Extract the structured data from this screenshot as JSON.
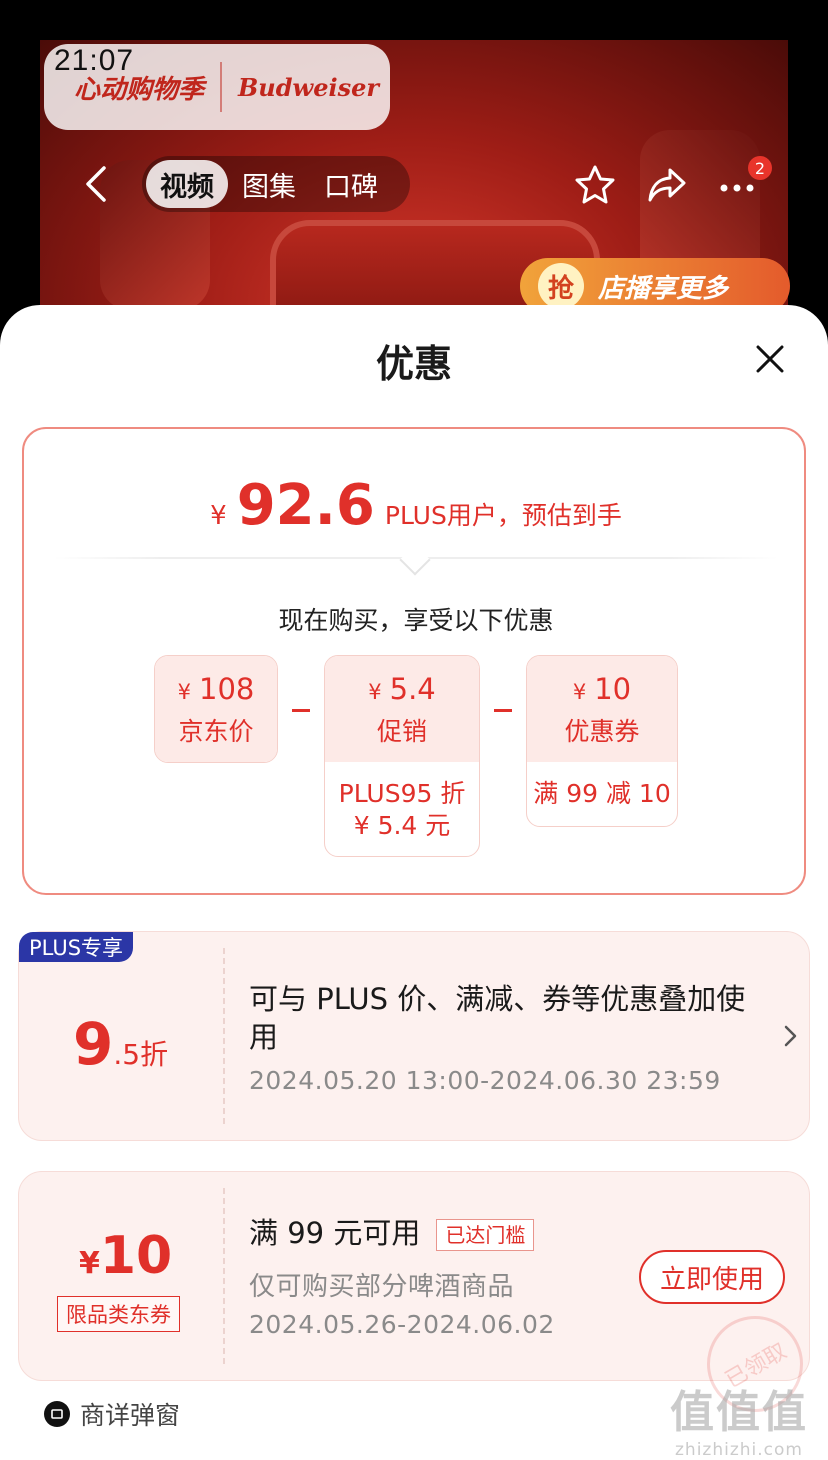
{
  "status_bar": {
    "time": "21:07"
  },
  "video": {
    "brand_left": "心动购物季",
    "brand_right": "Budweiser",
    "promo_icon": "抢",
    "promo_text": "店播享更多"
  },
  "nav": {
    "tabs": [
      {
        "label": "视频",
        "active": true
      },
      {
        "label": "图集",
        "active": false
      },
      {
        "label": "口碑",
        "active": false
      }
    ],
    "icons": [
      "back-icon",
      "star-icon",
      "share-icon",
      "more-icon"
    ],
    "more_badge": "2"
  },
  "sheet": {
    "title": "优惠",
    "summary": {
      "currency": "¥",
      "estimated_price": "92.6",
      "estimated_label": "PLUS用户，预估到手",
      "buy_note": "现在购买，享受以下优惠",
      "boxes": [
        {
          "value": "108",
          "caption": "京东价",
          "detail": []
        },
        {
          "value": "5.4",
          "caption": "促销",
          "detail": [
            "PLUS95 折",
            "¥ 5.4 元"
          ]
        },
        {
          "value": "10",
          "caption": "优惠券",
          "detail": [
            "满 99 减 10"
          ]
        }
      ],
      "operator": "-"
    },
    "plus_coupon": {
      "tag": "PLUS专享",
      "discount_big": "9",
      "discount_small": ".5折",
      "title": "可与 PLUS 价、满减、券等优惠叠加使用",
      "date": "2024.05.20 13:00-2024.06.30 23:59"
    },
    "jd_coupon": {
      "currency": "¥",
      "amount": "10",
      "type": "限品类东券",
      "title": "满 99 元可用",
      "reached_tag": "已达门槛",
      "subtitle": "仅可购买部分啤酒商品",
      "date": "2024.05.26-2024.06.02",
      "use_button": "立即使用",
      "stamp": "已领取"
    },
    "footer_source": "商详弹窗"
  },
  "watermark": {
    "line1": "值值值",
    "line2": "zhizhizhi.com"
  },
  "colors": {
    "accent": "#e0302a",
    "plus_tag": "#2b36a6",
    "coupon_bg": "#fdf1ef",
    "box_head_bg": "#fdeae7"
  }
}
